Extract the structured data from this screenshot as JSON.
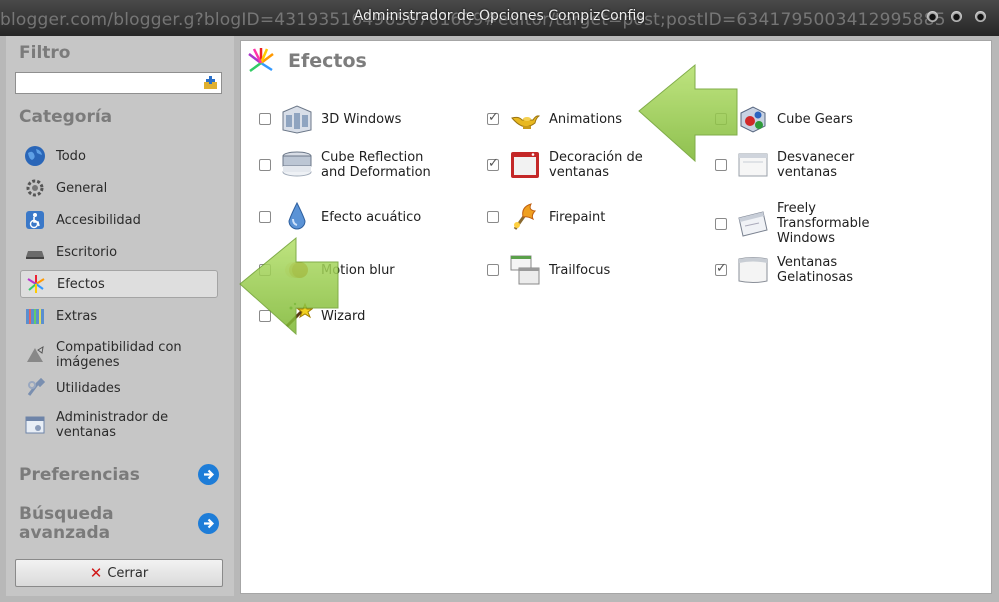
{
  "window": {
    "title": "Administrador de Opciones CompizConfig",
    "background_url": "blogger.com/blogger.g?blogID=4319351649656761609#editor/target=post;postID=6341795003412995885"
  },
  "sidebar": {
    "filter_label": "Filtro",
    "filter_value": "",
    "category_label": "Categoría",
    "categories": [
      {
        "label": "Todo",
        "icon": "globe-icon"
      },
      {
        "label": "General",
        "icon": "gear-icon"
      },
      {
        "label": "Accesibilidad",
        "icon": "wheelchair-icon"
      },
      {
        "label": "Escritorio",
        "icon": "desktop-icon"
      },
      {
        "label": "Efectos",
        "icon": "fireworks-icon",
        "selected": true
      },
      {
        "label": "Extras",
        "icon": "extras-icon"
      },
      {
        "label": "Compatibilidad con imágenes",
        "icon": "image-compat-icon"
      },
      {
        "label": "Utilidades",
        "icon": "utilities-icon"
      },
      {
        "label": "Administrador de ventanas",
        "icon": "window-manager-icon"
      }
    ],
    "preferences_label": "Preferencias",
    "advanced_search_label": "Búsqueda avanzada",
    "close_label": "Cerrar"
  },
  "main": {
    "title": "Efectos",
    "plugins": [
      {
        "label": "3D Windows",
        "checked": false,
        "icon": "3d-windows-icon"
      },
      {
        "label": "Animations",
        "checked": true,
        "icon": "magic-lamp-icon"
      },
      {
        "label": "Cube Gears",
        "checked": false,
        "icon": "cube-gears-icon"
      },
      {
        "label": "Cube Reflection and Deformation",
        "checked": false,
        "icon": "cube-reflection-icon"
      },
      {
        "label": "Decoración de ventanas",
        "checked": true,
        "icon": "window-decoration-icon"
      },
      {
        "label": "Desvanecer ventanas",
        "checked": false,
        "icon": "fade-windows-icon"
      },
      {
        "label": "Efecto acuático",
        "checked": false,
        "icon": "water-drop-icon"
      },
      {
        "label": "Firepaint",
        "checked": false,
        "icon": "firepaint-icon"
      },
      {
        "label": "Freely Transformable Windows",
        "checked": false,
        "icon": "transform-windows-icon"
      },
      {
        "label": "Motion blur",
        "checked": false,
        "icon": "motion-blur-icon"
      },
      {
        "label": "Trailfocus",
        "checked": false,
        "icon": "trailfocus-icon"
      },
      {
        "label": "Ventanas Gelatinosas",
        "checked": true,
        "icon": "wobbly-windows-icon"
      },
      {
        "label": "Wizard",
        "checked": false,
        "icon": "wizard-icon"
      }
    ]
  },
  "colors": {
    "accent_blue": "#1e7dd8",
    "arrow_green": "#8dc63f",
    "close_red": "#d01818"
  }
}
